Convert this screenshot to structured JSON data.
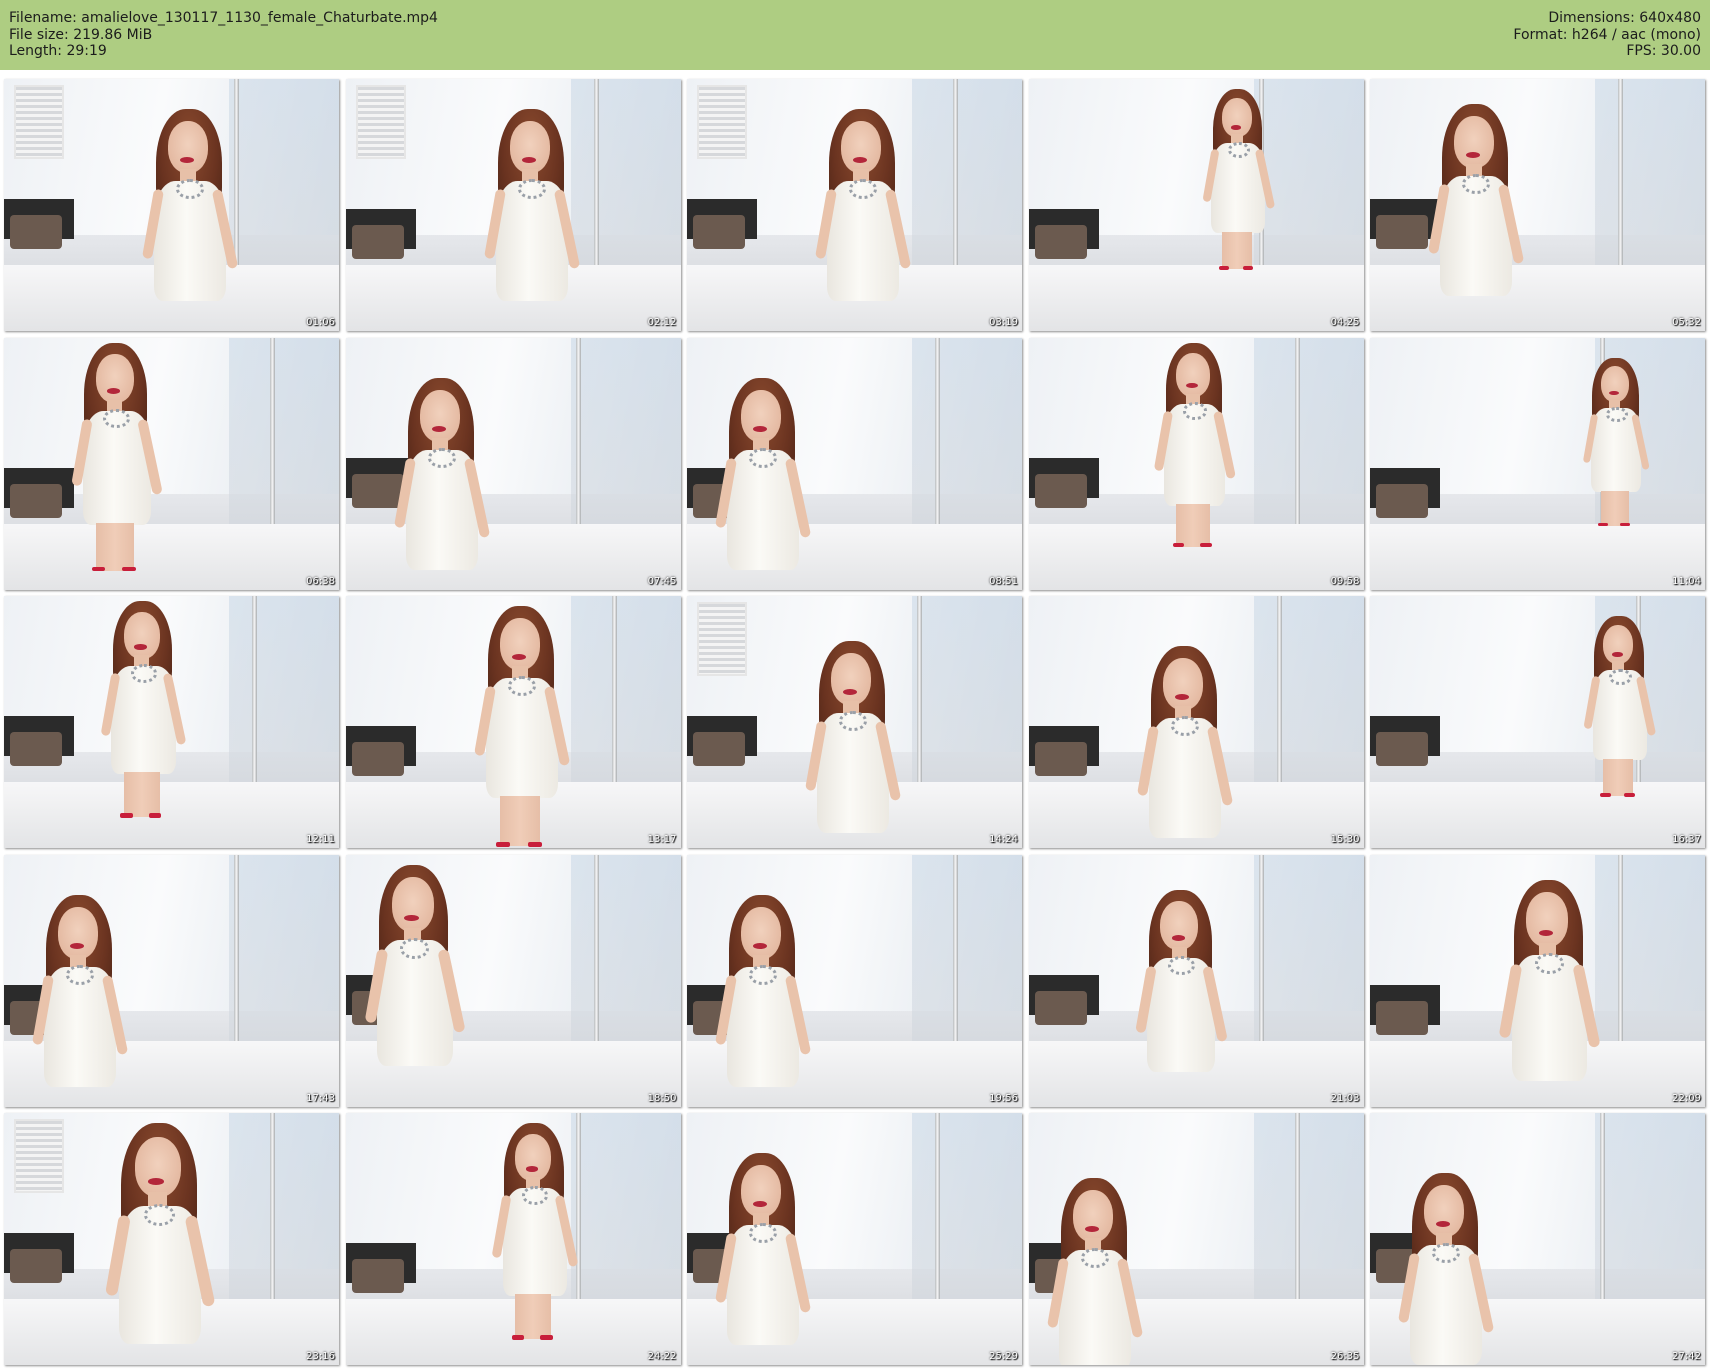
{
  "header": {
    "filename": "Filename: amalielove_130117_1130_female_Chaturbate.mp4",
    "filesize": "File size: 219.86 MiB",
    "length": "Length: 29:19",
    "dimensions": "Dimensions: 640x480",
    "format": "Format: h264 / aac (mono)",
    "fps": "FPS: 30.00"
  },
  "colors": {
    "header_bg": "#aecd82",
    "dress": "#f7f5ef",
    "hair": "#6a3320",
    "shoes": "#c81e3a"
  },
  "thumbnails": [
    {
      "time": "01:06"
    },
    {
      "time": "02:12"
    },
    {
      "time": "03:19"
    },
    {
      "time": "04:25"
    },
    {
      "time": "05:32"
    },
    {
      "time": "06:38"
    },
    {
      "time": "07:45"
    },
    {
      "time": "08:51"
    },
    {
      "time": "09:58"
    },
    {
      "time": "11:04"
    },
    {
      "time": "12:11"
    },
    {
      "time": "13:17"
    },
    {
      "time": "14:24"
    },
    {
      "time": "15:30"
    },
    {
      "time": "16:37"
    },
    {
      "time": "17:43"
    },
    {
      "time": "18:50"
    },
    {
      "time": "19:56"
    },
    {
      "time": "21:03"
    },
    {
      "time": "22:09"
    },
    {
      "time": "23:16"
    },
    {
      "time": "24:22"
    },
    {
      "time": "25:29"
    },
    {
      "time": "26:35"
    },
    {
      "time": "27:42"
    }
  ]
}
